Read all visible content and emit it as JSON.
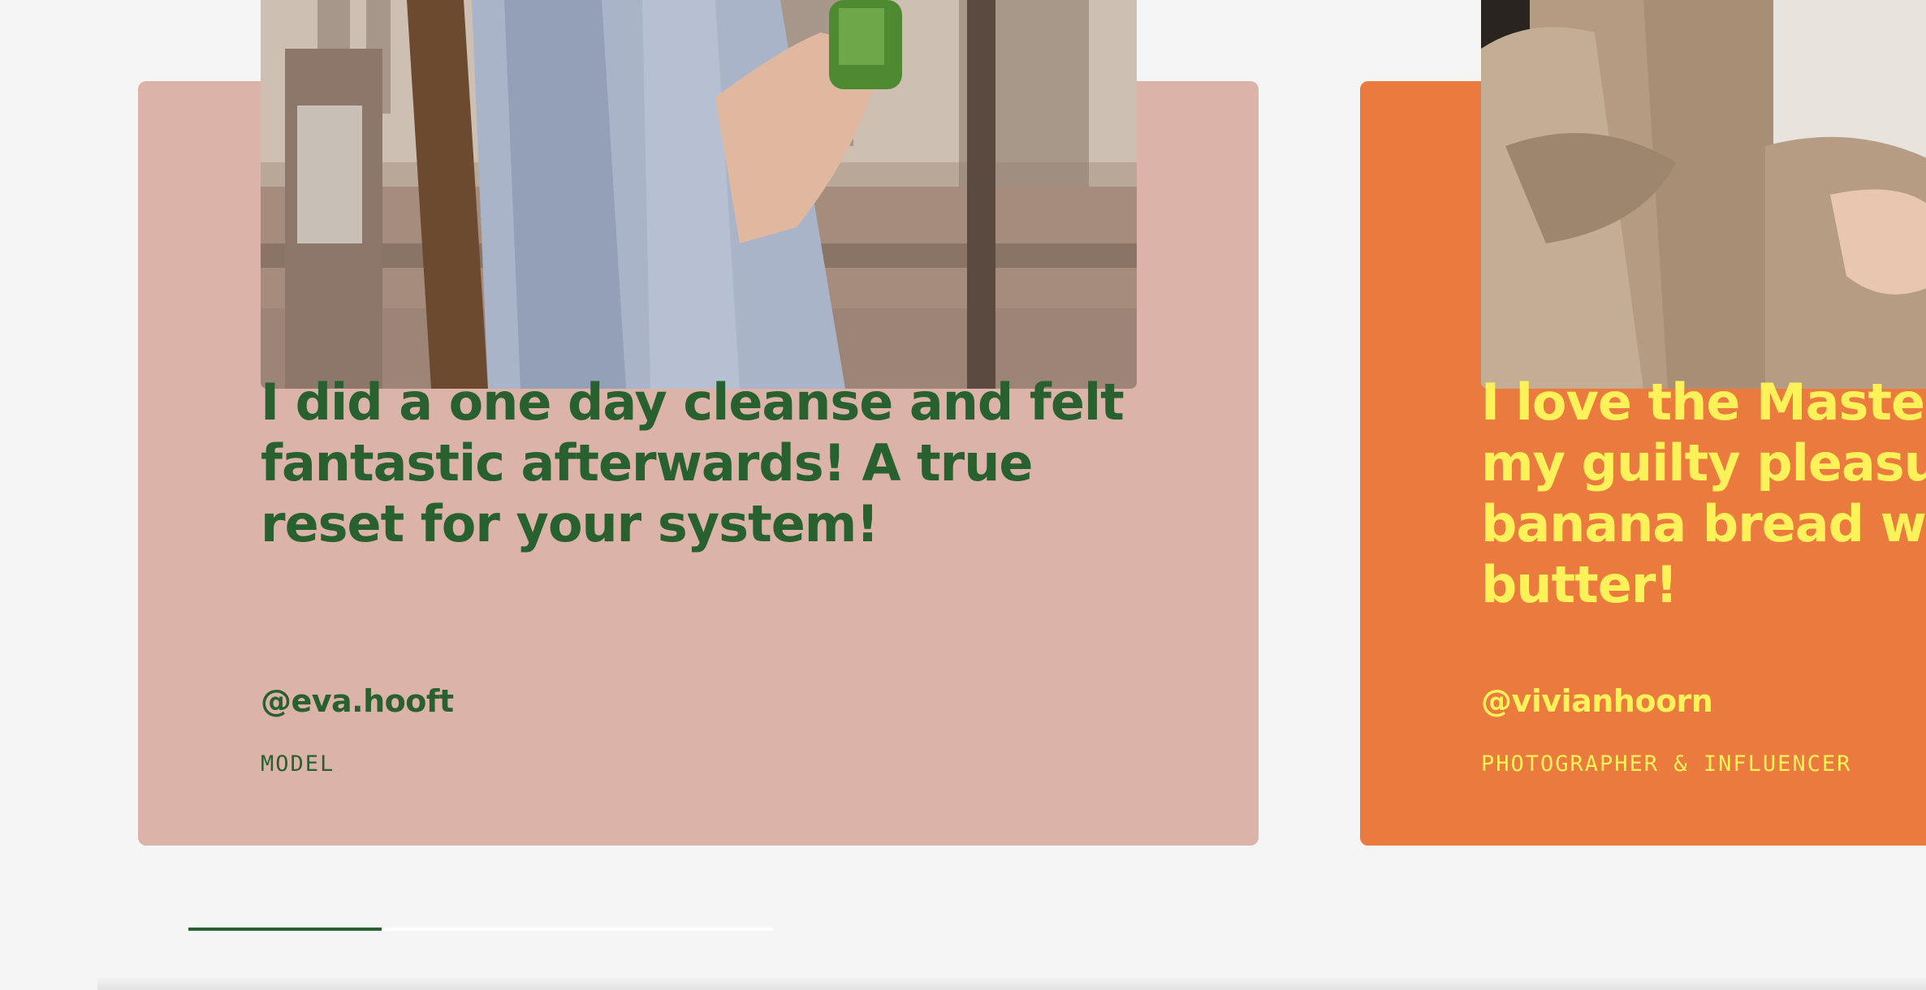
{
  "testimonials": [
    {
      "quote": "I did a one day cleanse and felt fantastic afterwards! A true reset for your system!",
      "handle": "@eva.hooft",
      "role": "MODEL",
      "background": "#dbb3a8",
      "text_color": "#28602f"
    },
    {
      "quote": "I love the Maste\nmy guilty pleasu\nbanana bread w\nbutter!",
      "handle": "@vivianhoorn",
      "role": "PHOTOGRAPHER & INFLUENCER",
      "background": "#eb7a3e",
      "text_color": "#fff15a"
    }
  ],
  "carousel": {
    "progress": 0.33,
    "track_color": "#ffffff",
    "fill_color": "#28602f"
  }
}
